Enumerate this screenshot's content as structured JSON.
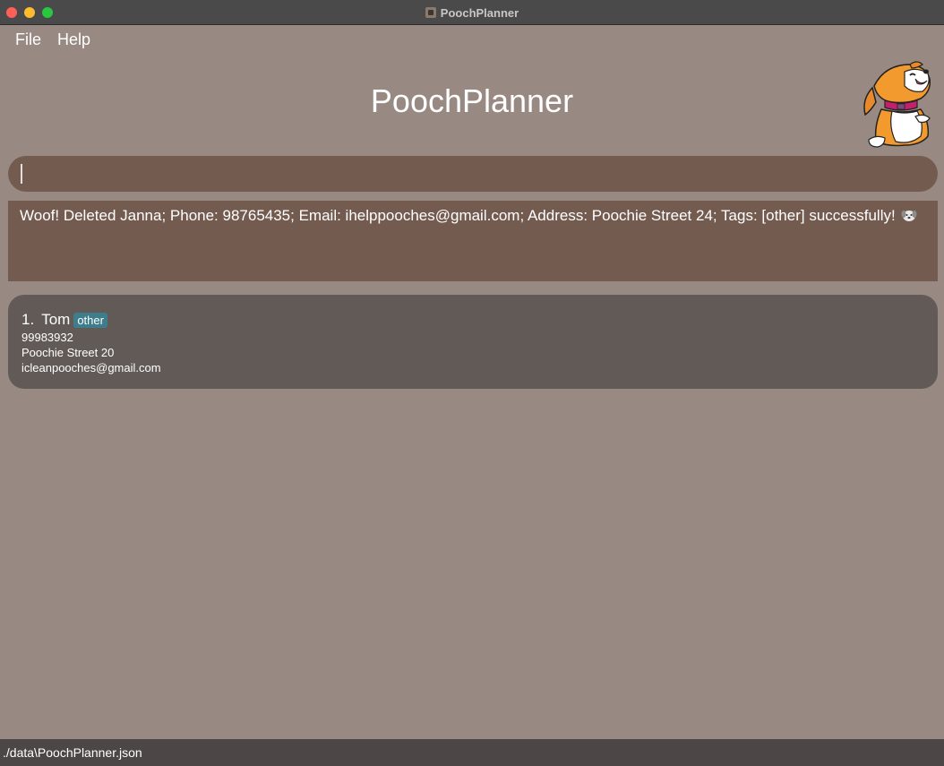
{
  "window": {
    "title": "PoochPlanner"
  },
  "menu": {
    "items": [
      "File",
      "Help"
    ]
  },
  "header": {
    "title": "PoochPlanner",
    "mascot_icon": "dog-mascot-icon"
  },
  "command": {
    "value": ""
  },
  "result": {
    "message": "Woof! Deleted Janna; Phone: 98765435; Email: ihelppooches@gmail.com; Address: Poochie Street 24; Tags: [other] successfully!",
    "emoji_icon": "dog-face-icon"
  },
  "persons": [
    {
      "index": "1.",
      "name": "Tom",
      "tags": [
        "other"
      ],
      "phone": "99983932",
      "address": "Poochie Street 20",
      "email": "icleanpooches@gmail.com"
    }
  ],
  "status": {
    "path": "./data\\PoochPlanner.json"
  },
  "colors": {
    "background": "#988a82",
    "command_box": "#745b50",
    "result_box": "#745b50",
    "list_panel": "#615a56",
    "tag": "#3e7d8c",
    "status_bar": "#4c4646"
  }
}
